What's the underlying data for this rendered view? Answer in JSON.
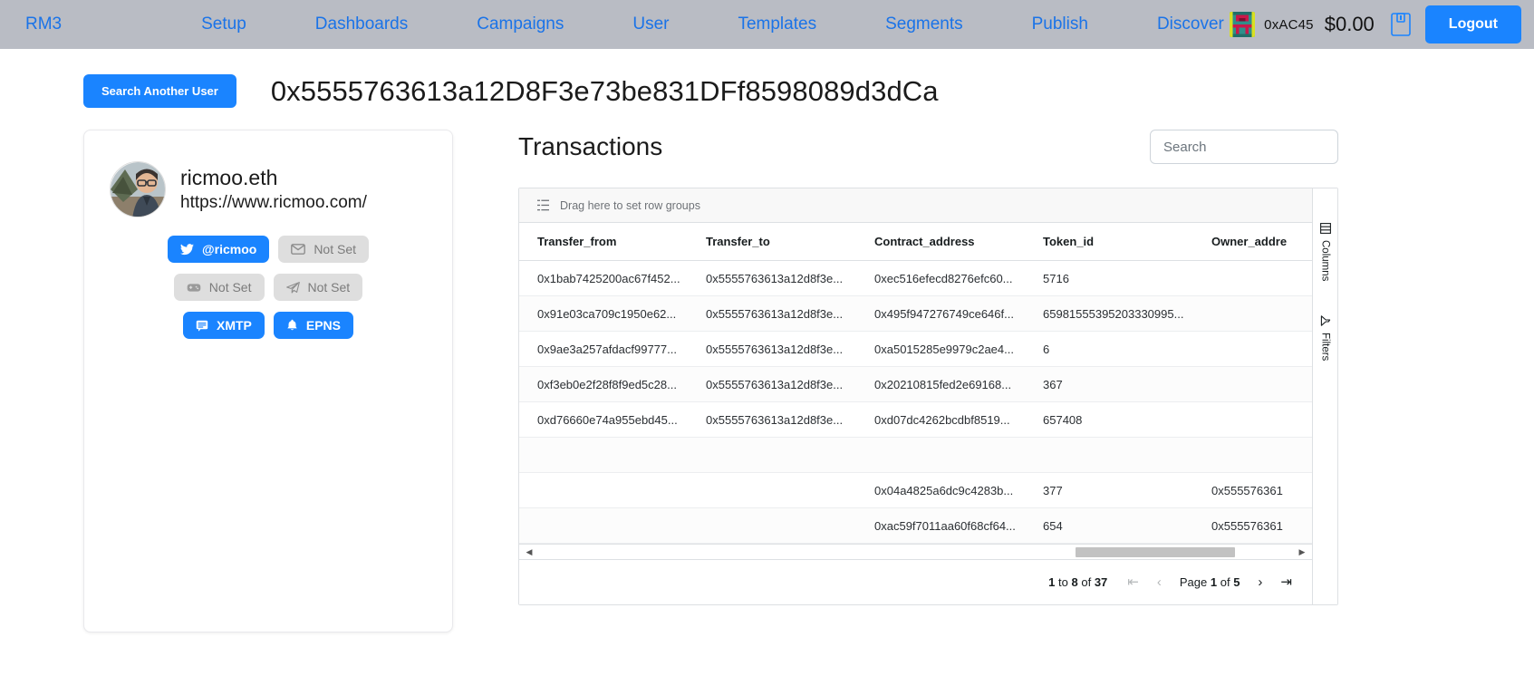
{
  "nav": {
    "brand": "RM3",
    "links": [
      "Setup",
      "Dashboards",
      "Campaigns",
      "User",
      "Templates",
      "Segments",
      "Publish",
      "Discover"
    ],
    "wallet_address": "0xAC45",
    "wallet_balance": "$0.00",
    "save_icon": "save-disk-icon",
    "logout_label": "Logout",
    "accent_color": "#1a84ff",
    "link_color": "#1a73e8",
    "bar_color": "#b9bcc4"
  },
  "header": {
    "search_another_label": "Search Another User",
    "user_address": "0x5555763613a12D8F3e73be831DFf8598089d3dCa"
  },
  "profile": {
    "avatar_icon": "user-avatar-photo",
    "name": "ricmoo.eth",
    "url": "https://www.ricmoo.com/",
    "badges": [
      {
        "icon": "twitter-icon",
        "label": "@ricmoo",
        "state": "on"
      },
      {
        "icon": "email-icon",
        "label": "Not Set",
        "state": "off"
      },
      {
        "icon": "discord-icon",
        "label": "Not Set",
        "state": "off"
      },
      {
        "icon": "telegram-icon",
        "label": "Not Set",
        "state": "off"
      },
      {
        "icon": "xmtp-icon",
        "label": "XMTP",
        "state": "on"
      },
      {
        "icon": "bell-icon",
        "label": "EPNS",
        "state": "on"
      }
    ]
  },
  "transactions": {
    "title": "Transactions",
    "search_placeholder": "Search",
    "search_value": "",
    "row_group_hint": "Drag here to set row groups",
    "columns": [
      "Transfer_from",
      "Transfer_to",
      "Contract_address",
      "Token_id",
      "Owner_addre"
    ],
    "rows": [
      {
        "Transfer_from": "0x1bab7425200ac67f452...",
        "Transfer_to": "0x5555763613a12d8f3e...",
        "Contract_address": "0xec516efecd8276efc60...",
        "Token_id": "5716",
        "Owner_addre": ""
      },
      {
        "Transfer_from": "0x91e03ca709c1950e62...",
        "Transfer_to": "0x5555763613a12d8f3e...",
        "Contract_address": "0x495f947276749ce646f...",
        "Token_id": "65981555395203330995...",
        "Owner_addre": ""
      },
      {
        "Transfer_from": "0x9ae3a257afdacf99777...",
        "Transfer_to": "0x5555763613a12d8f3e...",
        "Contract_address": "0xa5015285e9979c2ae4...",
        "Token_id": "6",
        "Owner_addre": ""
      },
      {
        "Transfer_from": "0xf3eb0e2f28f8f9ed5c28...",
        "Transfer_to": "0x5555763613a12d8f3e...",
        "Contract_address": "0x20210815fed2e69168...",
        "Token_id": "367",
        "Owner_addre": ""
      },
      {
        "Transfer_from": "0xd76660e74a955ebd45...",
        "Transfer_to": "0x5555763613a12d8f3e...",
        "Contract_address": "0xd07dc4262bcdbf8519...",
        "Token_id": "657408",
        "Owner_addre": ""
      },
      {
        "Transfer_from": "",
        "Transfer_to": "",
        "Contract_address": "",
        "Token_id": "",
        "Owner_addre": ""
      },
      {
        "Transfer_from": "",
        "Transfer_to": "",
        "Contract_address": "0x04a4825a6dc9c4283b...",
        "Token_id": "377",
        "Owner_addre": "0x555576361"
      },
      {
        "Transfer_from": "",
        "Transfer_to": "",
        "Contract_address": "0xac59f7011aa60f68cf64...",
        "Token_id": "654",
        "Owner_addre": "0x555576361"
      }
    ],
    "tool_panel": {
      "columns_label": "Columns",
      "columns_icon": "columns-grid-icon",
      "filters_label": "Filters",
      "filters_icon": "filter-funnel-icon"
    },
    "pagination": {
      "summary_prefix": "1",
      "summary_to": "to",
      "summary_end": "8",
      "summary_of": "of",
      "summary_total": "37",
      "first_icon": "first-page-icon",
      "prev_icon": "prev-page-icon",
      "next_icon": "next-page-icon",
      "last_icon": "last-page-icon",
      "page_word": "Page",
      "page_current": "1",
      "page_of": "of",
      "page_total": "5"
    }
  }
}
